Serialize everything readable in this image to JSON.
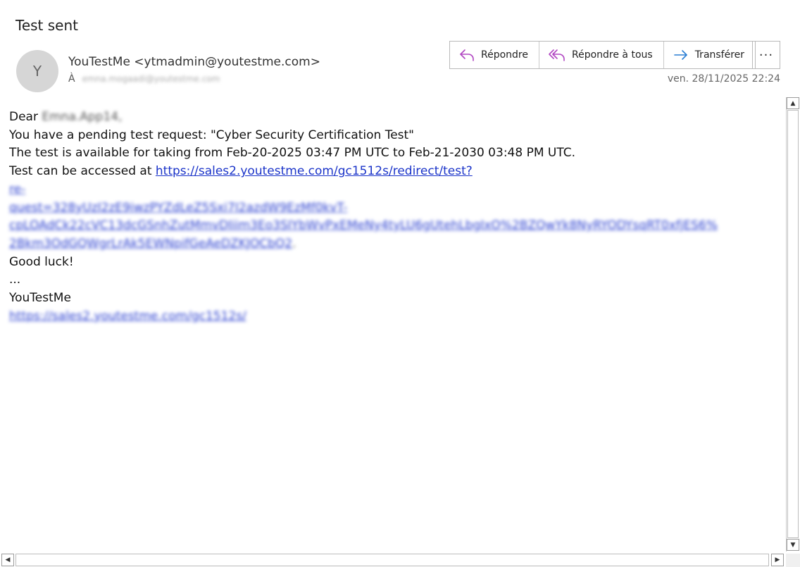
{
  "email": {
    "subject": "Test sent",
    "avatar_initial": "Y",
    "sender": "YouTestMe <ytmadmin@youtestme.com>",
    "to_label": "À",
    "to_address": "emna.mogaadi@youtestme.com",
    "date": "ven. 28/11/2025 22:24"
  },
  "actions": {
    "reply": "Répondre",
    "reply_all": "Répondre à tous",
    "forward": "Transférer",
    "more": "···"
  },
  "body": {
    "greeting": "Dear",
    "recipient_name": "Emna.App14,",
    "line1": "You have a pending test request: \"Cyber Security Certification Test\"",
    "line2": "The test is available for taking from Feb-20-2025 03:47 PM UTC to Feb-21-2030 03:48 PM UTC.",
    "line3_prefix": "Test can be accessed at ",
    "link_main": "https://sales2.youtestme.com/gc1512s/redirect/test?",
    "link_blur_1": "re-",
    "link_blur_2": "quest=328yUzI2zE9iwzPYZdLeZ5Sxi7I2azdW9EzMf0kvT-",
    "link_blur_3": "cpLOAdCk22cVC13dcGSnhZutMmvDIiim3Eo3SIYbWvPxEMeNy4tyLU6gUtehLbgIxO%2BZQwYk8NyRYODYsqRT0xfjES6%",
    "link_blur_4": "2Bkm3OdGQWgrLrAk5EWNpifGeAeDZKJOCbQ2",
    "link_blur_tail": ".",
    "good_luck": "Good luck!",
    "ellipsis": "...",
    "signature": "YouTestMe",
    "signature_link": "https://sales2.youtestme.com/gc1512s/"
  },
  "scrollbars": {
    "up": "▲",
    "down": "▼",
    "left": "◀",
    "right": "▶"
  }
}
